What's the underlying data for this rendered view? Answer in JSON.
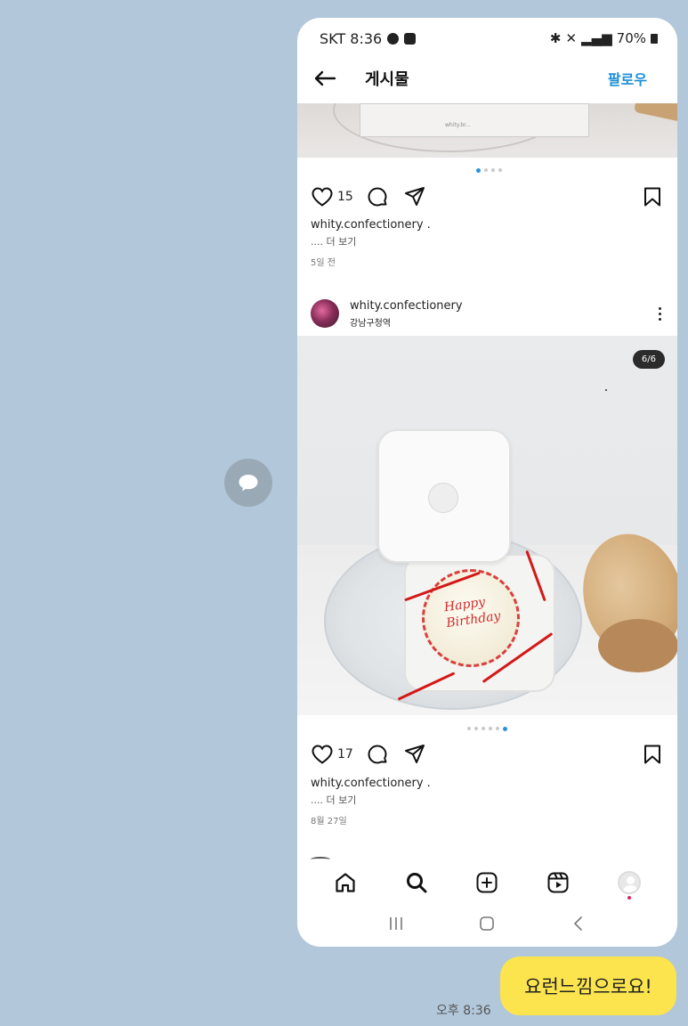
{
  "status": {
    "carrier_time": "SKT 8:36",
    "battery": "70%"
  },
  "header": {
    "title": "게시물",
    "follow_label": "팔로우"
  },
  "post1": {
    "likes": "15",
    "caption": "whity.confectionery .",
    "more": ".... 더 보기",
    "ago": "5일 전",
    "image_text": "whity.br..."
  },
  "post2": {
    "username": "whity.confectionery",
    "location": "강남구청역",
    "counter": "6/6",
    "cake_text_line1": "Happy",
    "cake_text_line2": "Birthday",
    "likes": "17",
    "caption": "whity.confectionery .",
    "more": ".... 더 보기",
    "date": "8월 27일"
  },
  "chat": {
    "bubble_text": "요런느낌으로요!",
    "time": "오후 8:36"
  },
  "colors": {
    "chat_background": "#b2c7da",
    "bubble": "#fce44e",
    "follow_blue": "#1a8fd8",
    "dot_active": "#2a91dd"
  },
  "icons": [
    "chat-share-icon",
    "back-arrow-icon",
    "heart-icon",
    "comment-icon",
    "send-icon",
    "bookmark-icon",
    "more-vert-icon",
    "home-icon",
    "search-icon",
    "add-icon",
    "reels-icon",
    "profile-icon",
    "recent-apps-icon",
    "home-button-icon",
    "system-back-icon"
  ],
  "carousel": {
    "post1_dot_count": 4,
    "post1_active_index": 0,
    "post2_dot_count": 6,
    "post2_active_index": 5
  }
}
